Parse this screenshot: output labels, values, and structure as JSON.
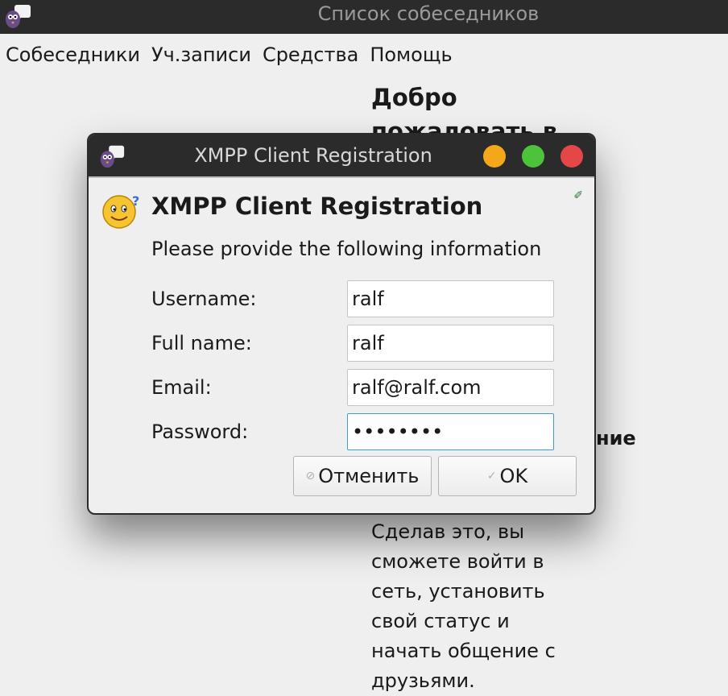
{
  "main_window": {
    "title": "Список собеседников",
    "menu": [
      "Собеседники",
      "Уч.записи",
      "Средства",
      "Помощь"
    ],
    "welcome_title": "Добро пожаловать в",
    "side_heading": "ние",
    "welcome_text": "Сделав это, вы сможете войти в сеть, установить свой статус и начать общение с друзьями."
  },
  "dialog": {
    "title": "XMPP Client Registration",
    "heading": "XMPP Client Registration",
    "subtitle": "Please provide the following information",
    "fields": [
      {
        "label": "Username:",
        "value": "ralf"
      },
      {
        "label": "Full name:",
        "value": "ralf"
      },
      {
        "label": "Email:",
        "value": "ralf@ralf.com"
      },
      {
        "label": "Password:",
        "value": "••••••••"
      }
    ],
    "cancel_label": "Отменить",
    "ok_label": "OK"
  },
  "icons": {
    "app": "pidgin-icon",
    "dialog_icon": "smiley-question-icon",
    "cancel": "cancel-icon",
    "ok": "check-icon"
  }
}
